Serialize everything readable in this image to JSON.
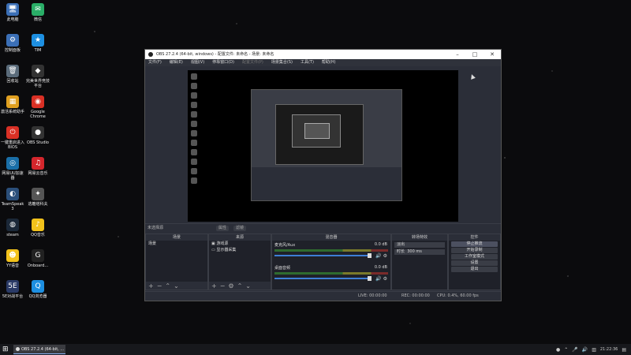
{
  "desktop": {
    "icons": [
      {
        "label": "此电脑",
        "glyph": "🖥",
        "color": "#3b6fb6"
      },
      {
        "label": "微信",
        "glyph": "✉",
        "color": "#2aae67"
      },
      {
        "label": "控制面板",
        "glyph": "⚙",
        "color": "#3b6fb6"
      },
      {
        "label": "TIM",
        "glyph": "★",
        "color": "#1d8fe1"
      },
      {
        "label": "回收站",
        "glyph": "🗑",
        "color": "#5a6b7a"
      },
      {
        "label": "完美世界竞技平台",
        "glyph": "◆",
        "color": "#333"
      },
      {
        "label": "激活系统助手",
        "glyph": "▦",
        "color": "#e0a020"
      },
      {
        "label": "Google Chrome",
        "glyph": "◉",
        "color": "#d93025"
      },
      {
        "label": "一键重启进入BIOS",
        "glyph": "⏻",
        "color": "#d93025"
      },
      {
        "label": "OBS Studio",
        "glyph": "●",
        "color": "#333"
      },
      {
        "label": "网易UU加速器",
        "glyph": "◎",
        "color": "#1a6fa8"
      },
      {
        "label": "网易云音乐",
        "glyph": "♫",
        "color": "#d4262c"
      },
      {
        "label": "TeamSpeak 3",
        "glyph": "◐",
        "color": "#2b4f7a"
      },
      {
        "label": "逃離塔科夫",
        "glyph": "✦",
        "color": "#555"
      },
      {
        "label": "steam",
        "glyph": "◍",
        "color": "#1b2838"
      },
      {
        "label": "QQ音乐",
        "glyph": "♪",
        "color": "#f2c21b"
      },
      {
        "label": "YY语音",
        "glyph": "☻",
        "color": "#f2c21b"
      },
      {
        "label": "Onboard...",
        "glyph": "G",
        "color": "#222"
      },
      {
        "label": "5E对战平台",
        "glyph": "5E",
        "color": "#2a3a66"
      },
      {
        "label": "QQ浏览器",
        "glyph": "Q",
        "color": "#1d8fe1"
      }
    ]
  },
  "window": {
    "title": "OBS 27.2.4 (64-bit, windows) - 配置文件: 未命名 - 场景: 未命名",
    "menu": [
      "文件(F)",
      "编辑(E)",
      "视图(V)",
      "停靠窗口(D)",
      "配置文件(P)",
      "场景集合(S)",
      "工具(T)",
      "帮助(H)"
    ]
  },
  "sourcebar": {
    "no_source": "未选择源",
    "props": "属性",
    "filters": "滤镜"
  },
  "docks": {
    "scenes": {
      "header": "场景",
      "items": [
        "场景"
      ]
    },
    "sources": {
      "header": "来源",
      "items": [
        "游戏源",
        "显示器采集"
      ]
    },
    "mixer": {
      "header": "混音器",
      "channels": [
        {
          "name": "麦克风/Aux",
          "db": "0.0 dB"
        },
        {
          "name": "桌面音频",
          "db": "0.0 dB"
        }
      ]
    },
    "transitions": {
      "header": "转场特效",
      "type": "淡出",
      "duration_label": "时长",
      "duration_value": "300 ms"
    },
    "controls": {
      "header": "控件",
      "buttons": [
        "停止推流",
        "开始录制",
        "工作室模式",
        "设置",
        "退出"
      ]
    }
  },
  "status": {
    "live": "LIVE: 00:00:00",
    "rec": "REC: 00:00:00",
    "cpu": "CPU: 0.4%, 60.00 fps"
  },
  "taskbar": {
    "task_label": "OBS 27.2.4 (64-bit, ...",
    "clock": "21:22:36"
  }
}
